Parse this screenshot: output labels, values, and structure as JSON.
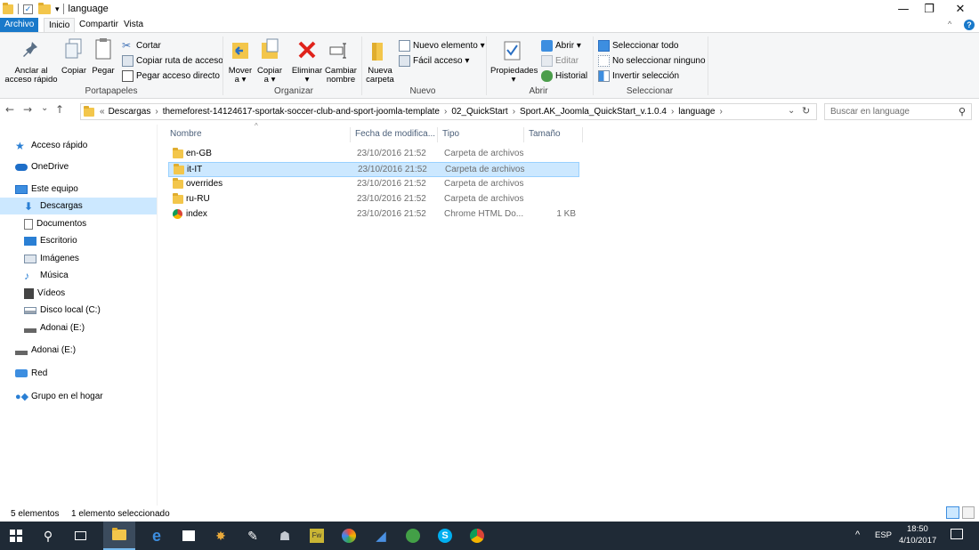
{
  "window": {
    "title": "language",
    "quick_access_dropdown": "▾",
    "minimize": "—",
    "restore": "❐",
    "close": "✕"
  },
  "ribbon_tabs": [
    "Archivo",
    "Inicio",
    "Compartir",
    "Vista"
  ],
  "ribbon": {
    "portapapeles": {
      "label": "Portapapeles",
      "anclar": "Anclar al acceso rápido",
      "copiar": "Copiar",
      "pegar": "Pegar",
      "cortar": "Cortar",
      "copiar_ruta": "Copiar ruta de acceso",
      "pegar_acceso": "Pegar acceso directo"
    },
    "organizar": {
      "label": "Organizar",
      "mover": "Mover a ▾",
      "copiar": "Copiar a ▾",
      "eliminar": "Eliminar ▾",
      "cambiar": "Cambiar nombre"
    },
    "nuevo": {
      "label": "Nuevo",
      "nueva_carpeta": "Nueva carpeta",
      "nuevo_elemento": "Nuevo elemento ▾",
      "facil_acceso": "Fácil acceso ▾"
    },
    "abrir": {
      "label": "Abrir",
      "propiedades": "Propiedades ▾",
      "abrir": "Abrir ▾",
      "editar": "Editar",
      "historial": "Historial"
    },
    "seleccionar": {
      "label": "Seleccionar",
      "todo": "Seleccionar todo",
      "ninguno": "No seleccionar ninguno",
      "invertir": "Invertir selección"
    }
  },
  "address": {
    "back": "←",
    "forward": "→",
    "recent": "⌄",
    "up": "↑",
    "overflow": "«",
    "segments": [
      "Descargas",
      "themeforest-14124617-sportak-soccer-club-and-sport-joomla-template",
      "02_QuickStart",
      "Sport.AK_Joomla_QuickStart_v.1.0.4",
      "language"
    ],
    "search_placeholder": "Buscar en language"
  },
  "nav": [
    {
      "label": "Acceso rápido",
      "icon": "star-icon"
    },
    {
      "label": "OneDrive",
      "icon": "cloud-icon"
    },
    {
      "label": "Este equipo",
      "icon": "computer-icon"
    },
    {
      "label": "Descargas",
      "icon": "download-icon"
    },
    {
      "label": "Documentos",
      "icon": "document-icon"
    },
    {
      "label": "Escritorio",
      "icon": "desktop-icon"
    },
    {
      "label": "Imágenes",
      "icon": "images-icon"
    },
    {
      "label": "Música",
      "icon": "music-icon"
    },
    {
      "label": "Vídeos",
      "icon": "video-icon"
    },
    {
      "label": "Disco local (C:)",
      "icon": "disk-icon"
    },
    {
      "label": "Adonai (E:)",
      "icon": "drive-icon"
    },
    {
      "label": "Adonai (E:)",
      "icon": "drive-icon"
    },
    {
      "label": "Red",
      "icon": "network-icon"
    },
    {
      "label": "Grupo en el hogar",
      "icon": "homegroup-icon"
    }
  ],
  "columns": [
    "Nombre",
    "Fecha de modifica...",
    "Tipo",
    "Tamaño"
  ],
  "files": [
    {
      "name": "en-GB",
      "date": "23/10/2016 21:52",
      "type": "Carpeta de archivos",
      "size": ""
    },
    {
      "name": "it-IT",
      "date": "23/10/2016 21:52",
      "type": "Carpeta de archivos",
      "size": ""
    },
    {
      "name": "overrides",
      "date": "23/10/2016 21:52",
      "type": "Carpeta de archivos",
      "size": ""
    },
    {
      "name": "ru-RU",
      "date": "23/10/2016 21:52",
      "type": "Carpeta de archivos",
      "size": ""
    },
    {
      "name": "index",
      "date": "23/10/2016 21:52",
      "type": "Chrome HTML Do...",
      "size": "1 KB"
    }
  ],
  "status": {
    "count": "5 elementos",
    "selected": "1 elemento seleccionado"
  },
  "taskbar": {
    "language": "ESP",
    "time": "18:50",
    "date": "4/10/2017",
    "tray_chevron": "^"
  },
  "colors": {
    "accent": "#1979ca",
    "selection": "#cce8ff",
    "taskbar": "#1f2a36"
  }
}
